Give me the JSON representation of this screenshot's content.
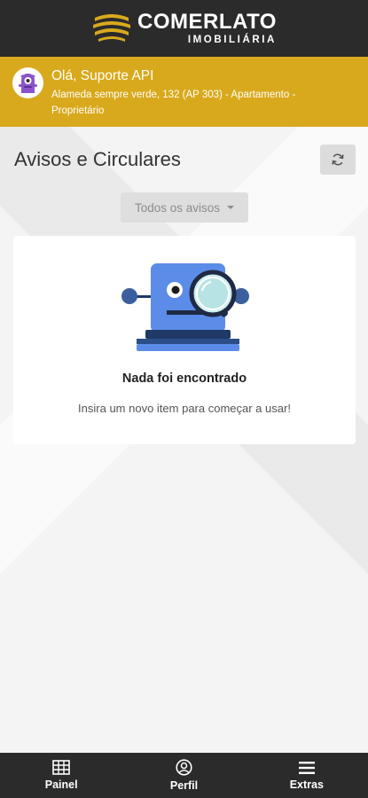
{
  "brand": {
    "name": "COMERLATO",
    "subtitle": "IMOBILIÁRIA"
  },
  "user": {
    "greeting": "Olá, Suporte API",
    "address": "Alameda sempre verde, 132 (AP 303) - Apartamento - Proprietário"
  },
  "page": {
    "title": "Avisos e Circulares",
    "refresh_icon": "refresh-icon"
  },
  "filter": {
    "selected": "Todos os avisos"
  },
  "empty_state": {
    "title": "Nada foi encontrado",
    "message": "Insira um novo item para começar a usar!"
  },
  "bottom_nav": {
    "items": [
      {
        "label": "Painel",
        "icon": "grid-icon"
      },
      {
        "label": "Perfil",
        "icon": "user-circle-icon"
      },
      {
        "label": "Extras",
        "icon": "menu-icon"
      }
    ]
  },
  "colors": {
    "header_bg": "#2b2b2b",
    "accent": "#d8a91c",
    "robot_blue": "#5b8de8"
  }
}
